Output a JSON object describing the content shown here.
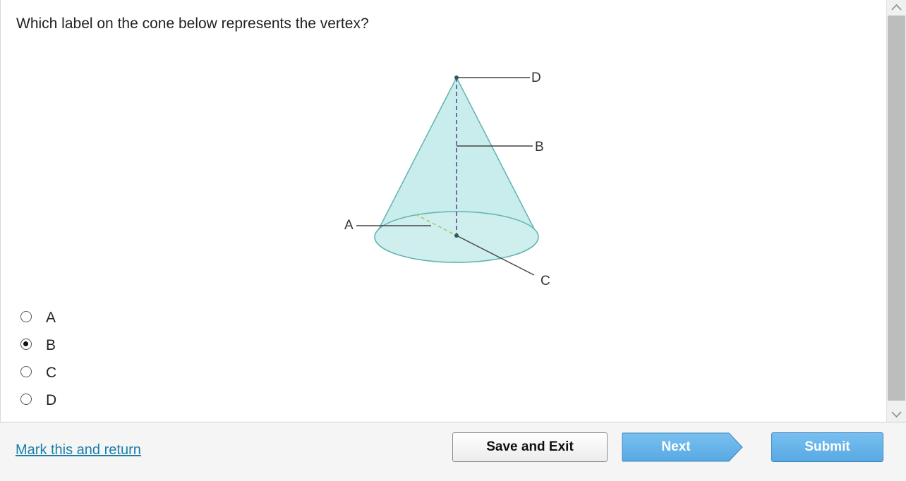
{
  "question": {
    "text": "Which label on the cone below represents the vertex?"
  },
  "figure": {
    "labels": {
      "a": "A",
      "b": "B",
      "c": "C",
      "d": "D"
    },
    "colors": {
      "fill": "#c9ecec",
      "stroke": "#5fb4b1",
      "height_dash": "#4a3f8c",
      "radius_dash": "#a4c86a"
    }
  },
  "options": [
    {
      "label": "A",
      "selected": false
    },
    {
      "label": "B",
      "selected": true
    },
    {
      "label": "C",
      "selected": false
    },
    {
      "label": "D",
      "selected": false
    }
  ],
  "footer": {
    "mark_link": "Mark this and return",
    "save_exit": "Save and Exit",
    "next": "Next",
    "submit": "Submit"
  },
  "colors": {
    "accent": "#5aabe4",
    "link": "#1a7fa8"
  }
}
